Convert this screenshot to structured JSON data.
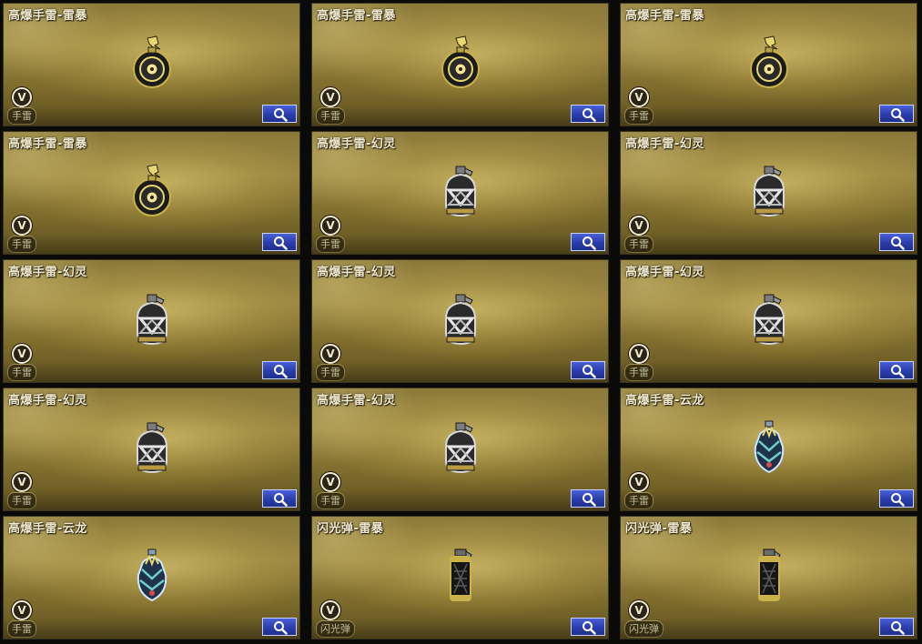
{
  "colors": {
    "card_gold": "#9a8641",
    "title_text": "#f1ead0",
    "search_blue": "#2a3dac"
  },
  "items": [
    {
      "name": "高爆手雷-雷暴",
      "type": "手雷",
      "badge": "V",
      "icon": "thunder-grenade-icon"
    },
    {
      "name": "高爆手雷-雷暴",
      "type": "手雷",
      "badge": "V",
      "icon": "thunder-grenade-icon"
    },
    {
      "name": "高爆手雷-雷暴",
      "type": "手雷",
      "badge": "V",
      "icon": "thunder-grenade-icon"
    },
    {
      "name": "高爆手雷-雷暴",
      "type": "手雷",
      "badge": "V",
      "icon": "thunder-grenade-icon"
    },
    {
      "name": "高爆手雷-幻灵",
      "type": "手雷",
      "badge": "V",
      "icon": "phantom-grenade-icon"
    },
    {
      "name": "高爆手雷-幻灵",
      "type": "手雷",
      "badge": "V",
      "icon": "phantom-grenade-icon"
    },
    {
      "name": "高爆手雷-幻灵",
      "type": "手雷",
      "badge": "V",
      "icon": "phantom-grenade-icon"
    },
    {
      "name": "高爆手雷-幻灵",
      "type": "手雷",
      "badge": "V",
      "icon": "phantom-grenade-icon"
    },
    {
      "name": "高爆手雷-幻灵",
      "type": "手雷",
      "badge": "V",
      "icon": "phantom-grenade-icon"
    },
    {
      "name": "高爆手雷-幻灵",
      "type": "手雷",
      "badge": "V",
      "icon": "phantom-grenade-icon"
    },
    {
      "name": "高爆手雷-幻灵",
      "type": "手雷",
      "badge": "V",
      "icon": "phantom-grenade-icon"
    },
    {
      "name": "高爆手雷-云龙",
      "type": "手雷",
      "badge": "V",
      "icon": "dragon-grenade-icon"
    },
    {
      "name": "高爆手雷-云龙",
      "type": "手雷",
      "badge": "V",
      "icon": "dragon-grenade-icon"
    },
    {
      "name": "闪光弹-雷暴",
      "type": "闪光弹",
      "badge": "V",
      "icon": "thunder-flashbang-icon"
    },
    {
      "name": "闪光弹-雷暴",
      "type": "闪光弹",
      "badge": "V",
      "icon": "thunder-flashbang-icon"
    }
  ]
}
